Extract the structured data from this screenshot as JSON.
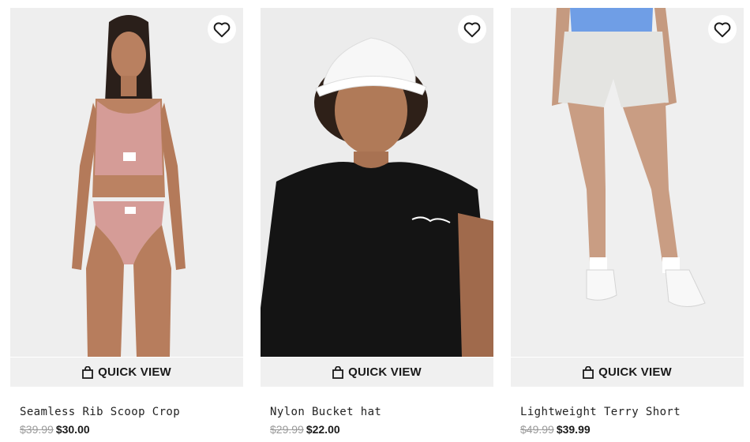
{
  "quick_view_label": "QUICK VIEW",
  "icons": {
    "wishlist": "heart-outline-icon",
    "quick_view": "shopping-bag-icon"
  },
  "colors": {
    "sale_price": "#1a1a1a",
    "original_price": "#9a9a9a",
    "image_background": "#efefef",
    "quick_view_background": "#f0f0f0"
  },
  "products": [
    {
      "name": "Seamless Rib Scoop Crop",
      "original_price": "$39.99",
      "sale_price": "$30.00"
    },
    {
      "name": "Nylon Bucket hat",
      "original_price": "$29.99",
      "sale_price": "$22.00"
    },
    {
      "name": "Lightweight Terry Short",
      "original_price": "$49.99",
      "sale_price": "$39.99"
    }
  ]
}
